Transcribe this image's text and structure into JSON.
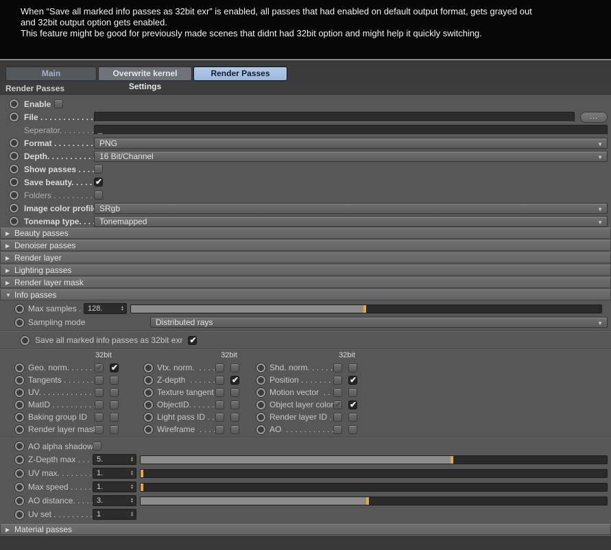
{
  "banner": {
    "lines": [
      "When “Save all marked info passes as 32bit exr” is enabled, all passes that had enabled on default output format, gets grayed out",
      "and 32bit output option gets enabled.",
      "This feature might be good for previously made scenes that didnt had 32bit option  and might help it quickly switching."
    ]
  },
  "tabs": {
    "main": "Main",
    "kernel": "Overwrite kernel Settings",
    "render_passes": "Render Passes"
  },
  "section": {
    "title": "Render Passes"
  },
  "icons": {
    "check": "✔",
    "dropdown_arrow": "▼",
    "spinner_up": "▲",
    "spinner_down": "▼",
    "collapsed_arrow": "▶",
    "expanded_arrow": "▼"
  },
  "colors": {
    "accent_tab": "#a6c1e3",
    "slider_handle": "#e9a63e",
    "slider_fill": "#8c8c8c"
  },
  "fields": {
    "enable": {
      "label": "Enable",
      "state": "cb-off"
    },
    "file": {
      "label": "File . . . . . . . . . . . . .",
      "value": "",
      "browse": "..."
    },
    "seperator": {
      "label": "Seperator. . . . . . . .",
      "value": "_"
    },
    "format": {
      "label": "Format . . . . . . . . . .",
      "value": "PNG"
    },
    "depth": {
      "label": "Depth. . . . . . . . . . .",
      "value": "16 Bit/Channel"
    },
    "show_passes": {
      "label": "Show passes . . . . .",
      "state": "cb-off"
    },
    "save_beauty": {
      "label": "Save beauty. . . . . .",
      "state": "cb-on"
    },
    "folders": {
      "label": "Folders . . . . . . . . . .",
      "state": "cb-off"
    },
    "image_color_profile": {
      "label": "Image color profile",
      "value": "SRgb"
    },
    "tonemap_type": {
      "label": "Tonemap type. . . .",
      "value": "Tonemapped"
    }
  },
  "groups": {
    "beauty": {
      "label": "Beauty passes",
      "arrow": "▶"
    },
    "denoiser": {
      "label": "Denoiser passes",
      "arrow": "▶"
    },
    "render_layer": {
      "label": "Render layer",
      "arrow": "▶"
    },
    "lighting": {
      "label": "Lighting passes",
      "arrow": "▶"
    },
    "render_layer_mask": {
      "label": "Render layer mask",
      "arrow": "▶"
    },
    "info": {
      "label": "Info passes",
      "arrow": "▼"
    },
    "material": {
      "label": "Material passes",
      "arrow": "▶"
    }
  },
  "info": {
    "max_samples": {
      "label": "Max samples . .",
      "value": "128.",
      "fraction": "50%"
    },
    "sampling_mode": {
      "label": "Sampling mode",
      "value": "Distributed rays"
    },
    "save_exr": {
      "label": "Save all marked info passes as 32bit exr",
      "state": "cb-on"
    },
    "col_header": "32bit",
    "grid": {
      "col1": [
        {
          "label": "Geo. norm. . . . . . .",
          "cb1": "cb-dis",
          "cb2": "cb-on"
        },
        {
          "label": "Tangents . . . . . . . .",
          "cb1": "cb-off",
          "cb2": "cb-off"
        },
        {
          "label": "UV. . . . . . . . . . . . . .",
          "cb1": "cb-off",
          "cb2": "cb-off"
        },
        {
          "label": "MatID . . . . . . . . . .",
          "cb1": "cb-off",
          "cb2": "cb-off"
        },
        {
          "label": "Baking group ID",
          "cb1": "cb-off",
          "cb2": "cb-off"
        },
        {
          "label": "Render layer mask",
          "cb1": "cb-off",
          "cb2": "cb-off"
        }
      ],
      "col2": [
        {
          "label": "Vtx. norm.  . . . .",
          "cb1": "cb-off",
          "cb2": "cb-off"
        },
        {
          "label": "Z-depth  . . . . . .",
          "cb1": "cb-off",
          "cb2": "cb-on"
        },
        {
          "label": "Texture tangent",
          "cb1": "cb-off",
          "cb2": "cb-off"
        },
        {
          "label": "ObjectID. . . . . .",
          "cb1": "cb-off",
          "cb2": "cb-off"
        },
        {
          "label": "Light pass ID . .",
          "cb1": "cb-off",
          "cb2": "cb-off"
        },
        {
          "label": "Wireframe  . . . .",
          "cb1": "cb-off",
          "cb2": "cb-off"
        }
      ],
      "col3": [
        {
          "label": "Shd. norm. . . . . . .",
          "cb1": "cb-off",
          "cb2": "cb-off"
        },
        {
          "label": "Position . . . . . . . .",
          "cb1": "cb-off",
          "cb2": "cb-on"
        },
        {
          "label": "Motion vector  . . .",
          "cb1": "cb-off",
          "cb2": "cb-off"
        },
        {
          "label": "Object layer color",
          "cb1": "cb-dis",
          "cb2": "cb-on"
        },
        {
          "label": "Render layer ID . .",
          "cb1": "cb-off",
          "cb2": "cb-off"
        },
        {
          "label": "AO  . . . . . . . . . . . .",
          "cb1": "cb-off",
          "cb2": "cb-off"
        }
      ]
    },
    "ao_alpha_shadow": {
      "label": "AO alpha shadow",
      "state": "cb-off"
    },
    "zdepth_max": {
      "label": "Z-Depth max . . . .",
      "value": "5.",
      "fraction": "67%"
    },
    "uv_max": {
      "label": "UV max. . . . . . . . .",
      "value": "1.",
      "fraction": "0.5%"
    },
    "max_speed": {
      "label": "Max speed . . . . . .",
      "value": "1.",
      "fraction": "0.5%"
    },
    "ao_distance": {
      "label": "AO distance. . . . .",
      "value": "3.",
      "fraction": "49%"
    },
    "uv_set": {
      "label": "Uv set . . . . . . . . . .",
      "value": "1"
    }
  }
}
